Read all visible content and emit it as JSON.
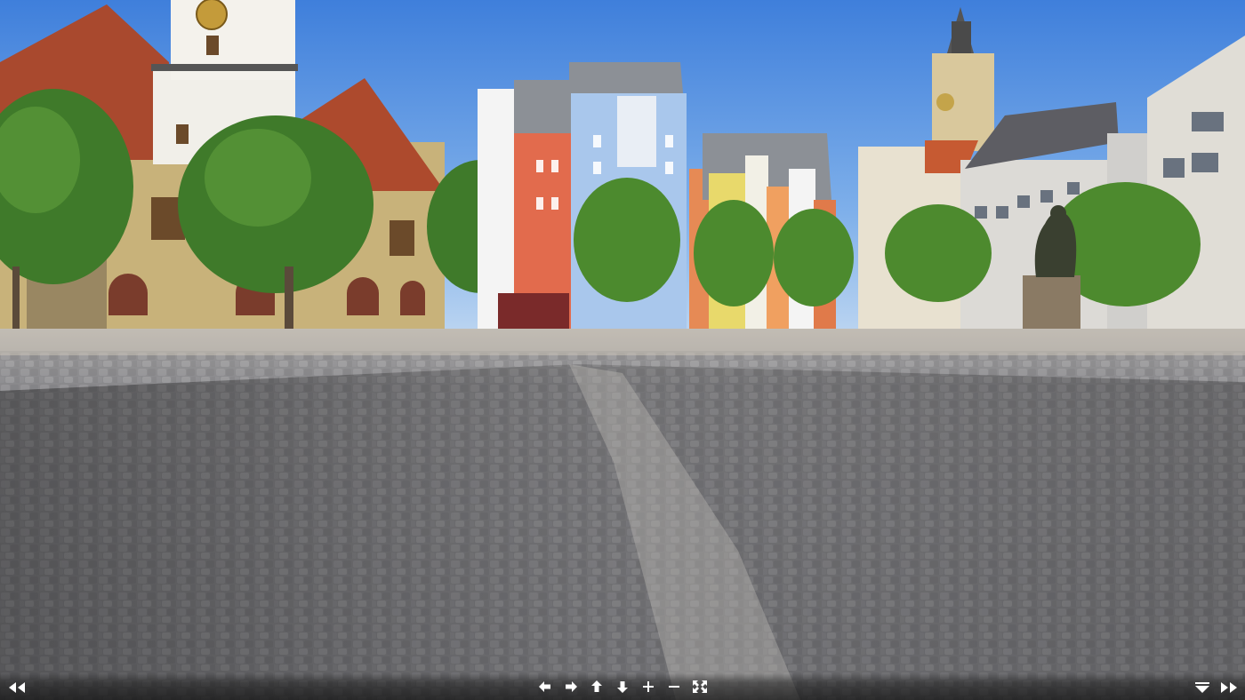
{
  "viewer": {
    "scene": "panorama-market-square",
    "colors": {
      "sky_top": "#3f7fdb",
      "sky_bottom": "#b9d3f0",
      "cobble": "#8a8a8d",
      "cobble_shadow": "#5e5f63",
      "toolbar_icon": "#ffffff"
    }
  },
  "controls": {
    "left": [
      {
        "id": "hide-left",
        "icon": "double-chevron-left-icon"
      }
    ],
    "center": [
      {
        "id": "pan-left",
        "icon": "arrow-left-icon"
      },
      {
        "id": "pan-right",
        "icon": "arrow-right-icon"
      },
      {
        "id": "tilt-up",
        "icon": "arrow-up-icon"
      },
      {
        "id": "tilt-down",
        "icon": "arrow-down-icon"
      },
      {
        "id": "zoom-in",
        "icon": "plus-icon"
      },
      {
        "id": "zoom-out",
        "icon": "minus-icon"
      },
      {
        "id": "fullscreen",
        "icon": "fullscreen-icon"
      }
    ],
    "right": [
      {
        "id": "collapse",
        "icon": "triangle-down-icon"
      },
      {
        "id": "hide-right",
        "icon": "double-chevron-right-icon"
      }
    ]
  }
}
